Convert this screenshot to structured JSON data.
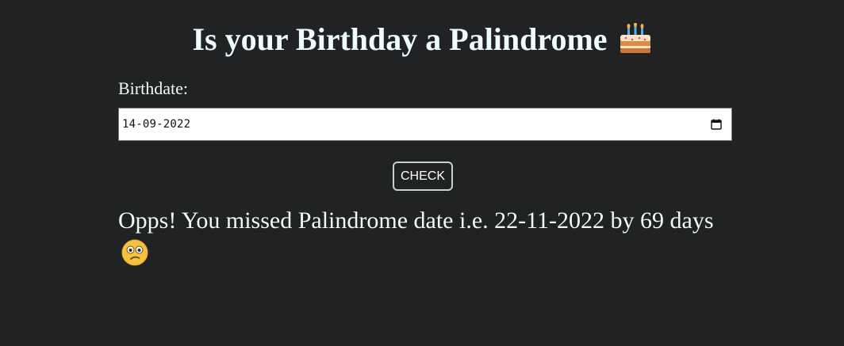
{
  "header": {
    "title": "Is your Birthday a Palindrome",
    "title_icon": "birthday-cake-icon"
  },
  "form": {
    "birthdate_label": "Birthdate:",
    "birthdate_value": "14-09-2022",
    "calendar_icon": "calendar-icon",
    "check_label": "CHECK"
  },
  "result": {
    "message": "Opps! You missed Palindrome date i.e. 22-11-2022 by 69 days",
    "icon": "confused-face-icon"
  },
  "colors": {
    "background": "#202224",
    "text": "#f0f8f8",
    "input_bg": "#ffffff",
    "button_border": "#c9d0d0"
  }
}
